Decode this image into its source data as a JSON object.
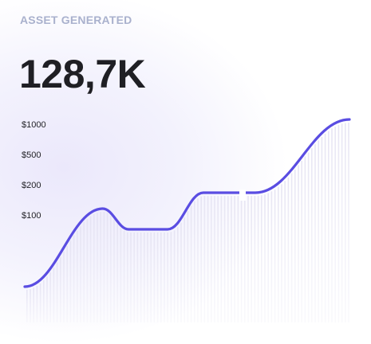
{
  "card": {
    "label": "ASSET GENERATED",
    "value": "128,7K"
  },
  "colors": {
    "line": "#5a4de2",
    "bars": "#e7e5f3",
    "label": "#a9b1cd",
    "text": "#1f1f24"
  },
  "chart_data": {
    "type": "line",
    "yticks": [
      "$1000",
      "$500",
      "$200",
      "$100"
    ],
    "series": [
      {
        "values_approx": [
          [
            0.0,
            0.0
          ],
          [
            0.24,
            0.49
          ],
          [
            0.32,
            0.36
          ],
          [
            0.44,
            0.36
          ],
          [
            0.55,
            0.59
          ],
          [
            0.71,
            0.59
          ],
          [
            1.0,
            1.05
          ]
        ]
      }
    ],
    "y_scale": "log",
    "grid": false
  }
}
